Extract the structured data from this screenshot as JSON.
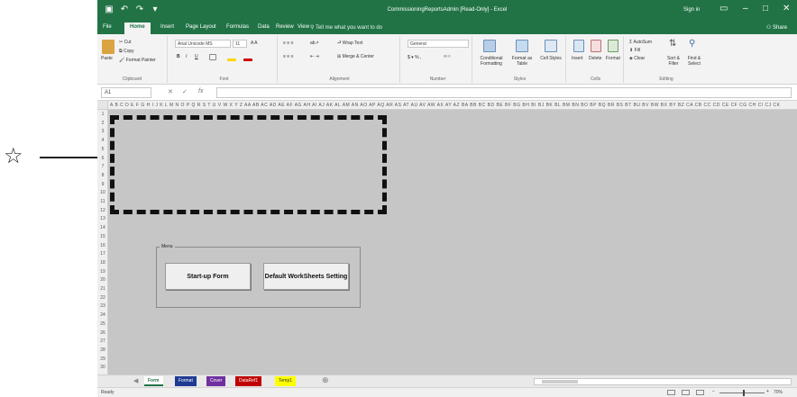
{
  "callout": {
    "star": "☆"
  },
  "window": {
    "title": "CommissioningReportsAdmin [Read-Only] - Excel",
    "sign_in": "Sign in"
  },
  "ribbon_tabs": [
    "File",
    "Home",
    "Insert",
    "Page Layout",
    "Formulas",
    "Data",
    "Review",
    "View"
  ],
  "tell_me": "Tell me what you want to do",
  "share": "Share",
  "clipboard": {
    "paste": "Paste",
    "cut": "Cut",
    "copy": "Copy",
    "format_painter": "Format Painter",
    "label": "Clipboard"
  },
  "font": {
    "name": "Arial Unicode MS",
    "size": "11",
    "label": "Font"
  },
  "alignment": {
    "wrap_text": "Wrap Text",
    "merge_center": "Merge & Center",
    "label": "Alignment"
  },
  "number": {
    "format": "General",
    "label": "Number"
  },
  "styles": {
    "conditional": "Conditional Formatting",
    "format_as_table": "Format as Table",
    "cell_styles": "Cell Styles",
    "label": "Styles"
  },
  "cells": {
    "insert": "Insert",
    "delete": "Delete",
    "format": "Format",
    "label": "Cells"
  },
  "editing": {
    "autosum": "AutoSum",
    "fill": "Fill",
    "clear": "Clear",
    "sort_filter": "Sort & Filter",
    "find_select": "Find & Select",
    "label": "Editing"
  },
  "formula_bar": {
    "name_box": "A1",
    "fx": "fx"
  },
  "columns": "A B C D E F G H I J K L M N O P Q R S T U V W X Y Z AA AB AC AD AE AF AG AH AI AJ AK AL AM AN AO AP AQ AR AS AT AU AV AW AX AY AZ BA BB BC BD BE BF BG BH BI BJ BK BL BM BN BO BP BQ BR BS BT BU BV BW BX BY BZ CA CB CC CD CE CF CG CH CI CJ CK",
  "rows": [
    "1",
    "2",
    "3",
    "4",
    "5",
    "6",
    "7",
    "8",
    "9",
    "10",
    "11",
    "12",
    "13",
    "14",
    "15",
    "16",
    "17",
    "18",
    "19",
    "20",
    "21",
    "22",
    "23",
    "24",
    "25",
    "26",
    "27",
    "28",
    "29",
    "30"
  ],
  "menu": {
    "caption": "Menu",
    "startup_button": "Start-up Form",
    "default_button": "Default WorkSheets Setting"
  },
  "sheets": [
    {
      "name": "Form",
      "bg": "#ffffff",
      "color": "#217346"
    },
    {
      "name": "Format",
      "bg": "#1f3a93",
      "color": "#ffffff"
    },
    {
      "name": "Cover",
      "bg": "#7030a0",
      "color": "#ffffff"
    },
    {
      "name": "DataRef1",
      "bg": "#c00000",
      "color": "#ffffff"
    },
    {
      "name": "Temp1",
      "bg": "#ffff00",
      "color": "#333333"
    }
  ],
  "status": {
    "text": "Ready",
    "zoom": "70%"
  },
  "colors": {
    "excel_green": "#217346",
    "grid_gray": "#c6c6c6"
  }
}
